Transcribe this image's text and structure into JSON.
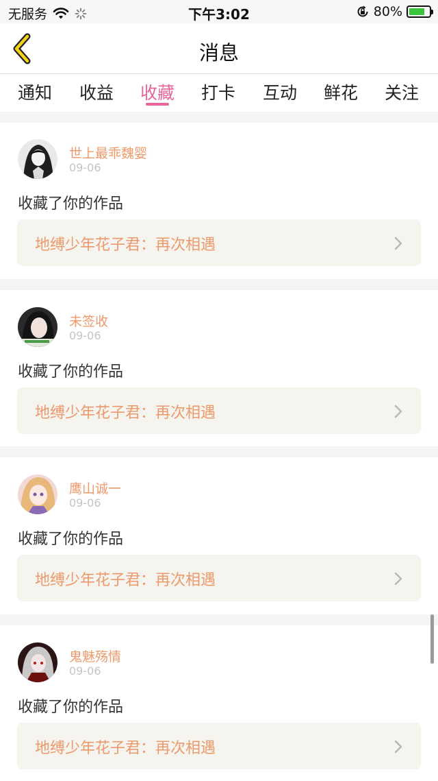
{
  "status_bar": {
    "carrier": "无服务",
    "time": "下午3:02",
    "battery_percent": "80%",
    "battery_level": 0.8
  },
  "nav": {
    "title": "消息"
  },
  "tabs": [
    {
      "label": "通知"
    },
    {
      "label": "收益"
    },
    {
      "label": "收藏",
      "active": true
    },
    {
      "label": "打卡"
    },
    {
      "label": "互动"
    },
    {
      "label": "鲜花"
    },
    {
      "label": "关注"
    }
  ],
  "notifications": [
    {
      "username": "世上最乖魏婴",
      "date": "09-06",
      "action": "收藏了你的作品",
      "work_title": "地缚少年花子君：再次相遇"
    },
    {
      "username": "未签收",
      "date": "09-06",
      "action": "收藏了你的作品",
      "work_title": "地缚少年花子君：再次相遇"
    },
    {
      "username": "鹰山诚一",
      "date": "09-06",
      "action": "收藏了你的作品",
      "work_title": "地缚少年花子君：再次相遇"
    },
    {
      "username": "鬼魅殇情",
      "date": "09-06",
      "action": "收藏了你的作品",
      "work_title": "地缚少年花子君：再次相遇"
    }
  ],
  "colors": {
    "accent": "#e8649a",
    "username": "#ec9a6c",
    "link_bg": "#f5f4ee"
  },
  "icons": {
    "back": "chevron-left-icon",
    "wifi": "wifi-icon",
    "loading": "spinner-icon",
    "rotation_lock": "rotation-lock-icon",
    "battery": "battery-charging-icon",
    "link": "chevron-right-icon"
  }
}
